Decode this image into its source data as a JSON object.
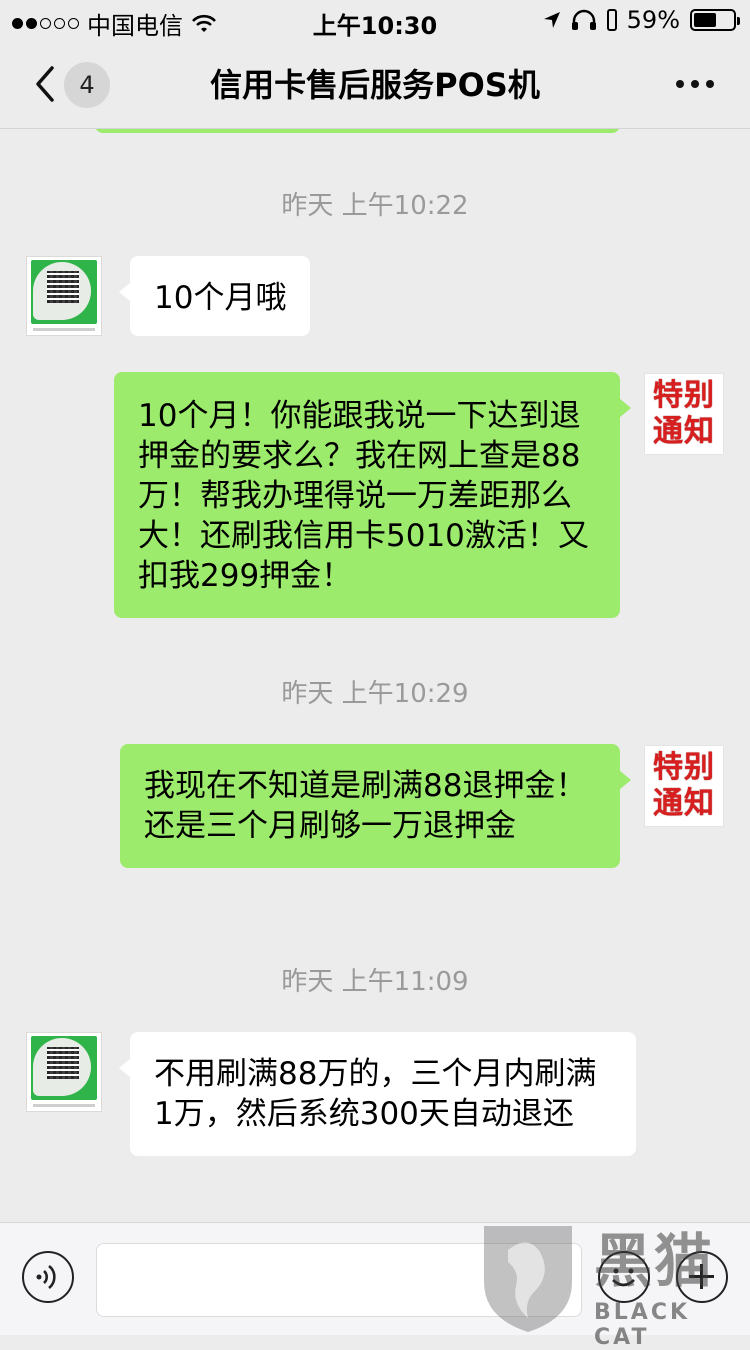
{
  "status_bar": {
    "carrier": "中国电信",
    "time": "上午10:30",
    "battery": "59%",
    "battery_level": 0.59,
    "signal_dots_filled": 2,
    "signal_dots_total": 5
  },
  "nav": {
    "back_count": "4",
    "title": "信用卡售后服务POS机"
  },
  "messages": [
    {
      "type": "time",
      "text": "昨天 上午10:22"
    },
    {
      "type": "left",
      "text": "10个月哦"
    },
    {
      "type": "right",
      "text": "10个月！你能跟我说一下达到退押金的要求么？我在网上查是88万！帮我办理得说一万差距那么大！还刷我信用卡5010激活！又扣我299押金！",
      "avatar_text": "特别通知"
    },
    {
      "type": "time",
      "text": "昨天 上午10:29"
    },
    {
      "type": "right",
      "text": "我现在不知道是刷满88退押金！还是三个月刷够一万退押金",
      "avatar_text": "特别通知"
    },
    {
      "type": "time",
      "text": "昨天 上午11:09"
    },
    {
      "type": "left",
      "text": "不用刷满88万的，三个月内刷满1万，然后系统300天自动退还"
    }
  ],
  "watermark": {
    "han": "黑猫",
    "en": "BLACK CAT"
  },
  "icons": {
    "back": "chevron-left-icon",
    "more": "more-dots-icon",
    "voice": "voice-icon",
    "emoji": "emoji-icon",
    "plus": "plus-icon"
  },
  "colors": {
    "sent_bubble": "#9ceb6c",
    "received_bubble": "#ffffff",
    "background": "#ececec",
    "notice_red": "#d81f1f"
  }
}
